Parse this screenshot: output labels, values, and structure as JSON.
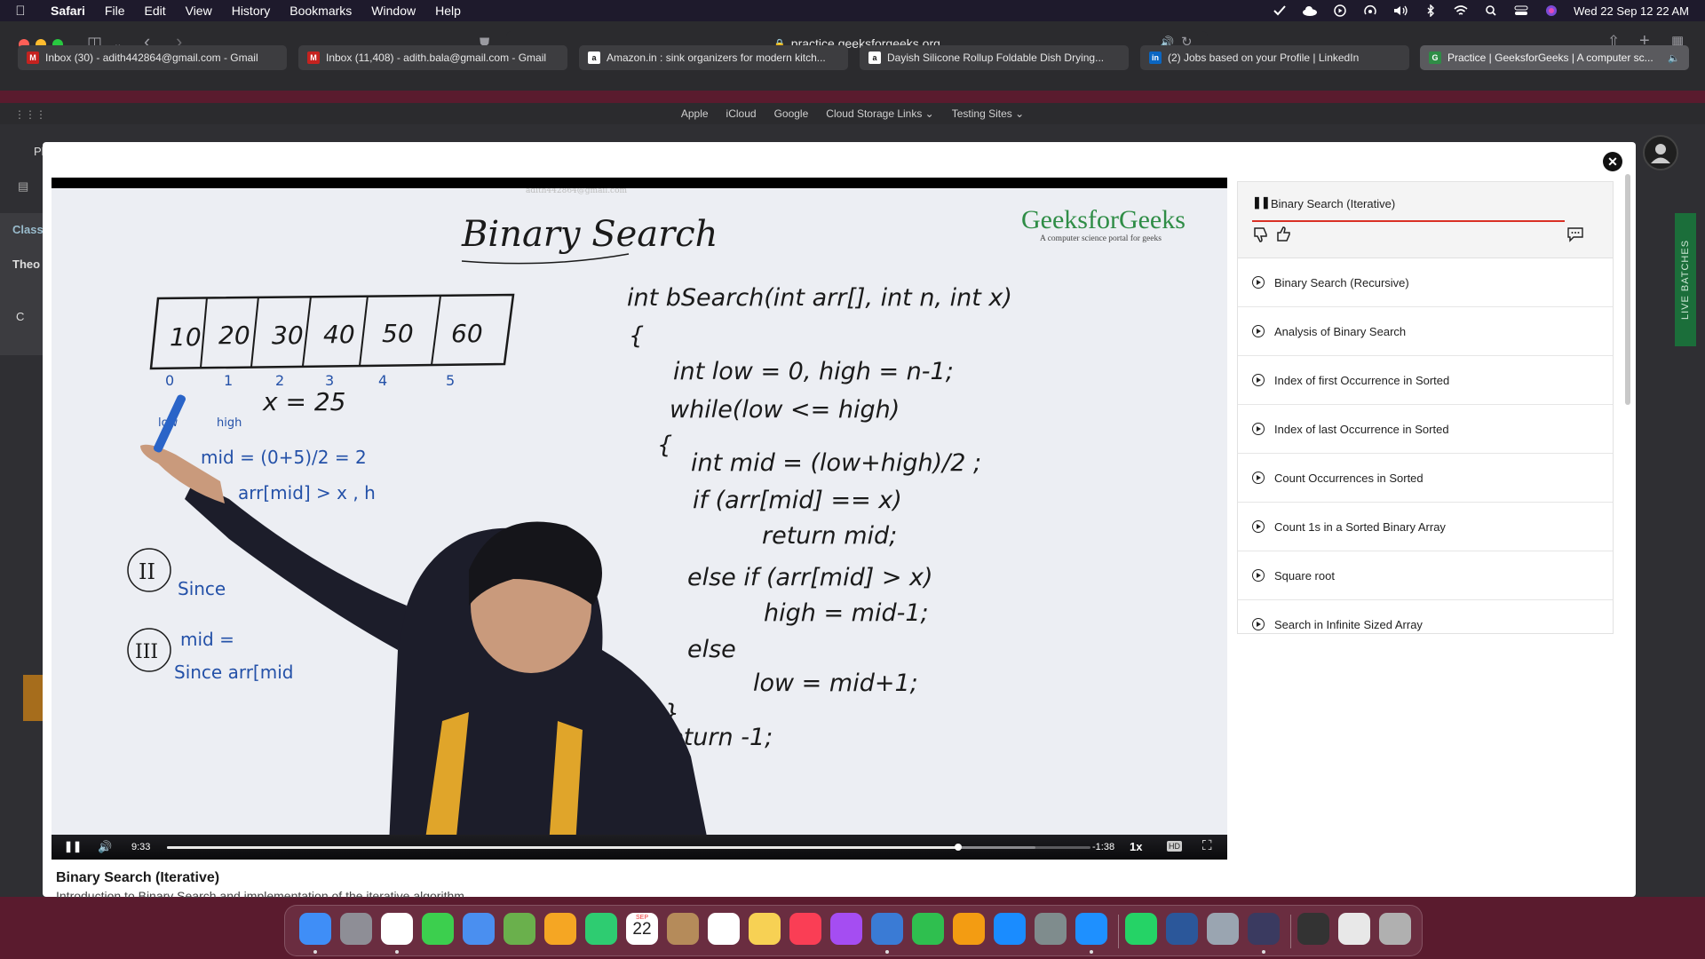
{
  "menubar": {
    "apple_icon": "apple-icon",
    "items": [
      "Safari",
      "File",
      "Edit",
      "View",
      "History",
      "Bookmarks",
      "Window",
      "Help"
    ],
    "clock": "Wed 22 Sep  12 22 AM",
    "status_icons": [
      "antivirus-icon",
      "cloud-icon",
      "play-circle-icon",
      "airdrop-icon",
      "volume-icon",
      "bluetooth-icon",
      "wifi-icon",
      "search-icon",
      "control-center-icon",
      "siri-icon"
    ]
  },
  "browser": {
    "url": "practice.geeksforgeeks.org",
    "tabs": [
      {
        "label": "Inbox (30) - adith442864@gmail.com - Gmail",
        "icon": "gmail-icon"
      },
      {
        "label": "Inbox (11,408) - adith.bala@gmail.com - Gmail",
        "icon": "gmail-icon"
      },
      {
        "label": "Amazon.in : sink organizers for modern kitch...",
        "icon": "amazon-icon"
      },
      {
        "label": "Dayish Silicone Rollup Foldable Dish Drying...",
        "icon": "amazon-icon"
      },
      {
        "label": "(2) Jobs based on your Profile | LinkedIn",
        "icon": "linkedin-icon"
      },
      {
        "label": "Practice | GeeksforGeeks | A computer sc...",
        "icon": "gfg-icon"
      }
    ],
    "favorites": [
      "Apple",
      "iCloud",
      "Google",
      "Cloud Storage Links ⌄",
      "Testing Sites ⌄"
    ]
  },
  "page_bg": {
    "snippets": [
      "Pl",
      "Class",
      "Theo",
      "C",
      "LIVE BATCHES"
    ]
  },
  "video": {
    "watermark": "adith442864@gmail.com",
    "logo_title": "GeeksforGeeks",
    "logo_tagline": "A computer science portal for geeks",
    "board": {
      "heading": "Binary Search",
      "array_values": [
        "10",
        "20",
        "30",
        "40",
        "50",
        "60"
      ],
      "array_indices": [
        "0",
        "1",
        "2",
        "3",
        "4",
        "5"
      ],
      "low_label": "low",
      "high_label": "high",
      "x_eq": "x = 25",
      "mid_eq": "mid = (0+5)/2 = 2",
      "arr_cmp": "arr[mid] > x , h",
      "step_two": "II",
      "step_three": "III",
      "since_label": "Since",
      "mid_line": "mid =",
      "since_arr": "Since arr[mid",
      "code": [
        "int bSearch(int arr[], int n, int x)",
        "{",
        "int low = 0, high = n-1;",
        "while(low <= high)",
        "{",
        "int mid = (low+high)/2 ;",
        "if (arr[mid] == x)",
        "return mid;",
        "else if (arr[mid] > x)",
        "high = mid-1;",
        "else",
        "low = mid+1;",
        "}",
        "return -1;",
        "}"
      ]
    },
    "controls": {
      "elapsed": "9:33",
      "remaining": "-1:38",
      "speed": "1x",
      "progress": 0.857,
      "buffered": 0.94
    },
    "title": "Binary Search (Iterative)",
    "description": "Introduction to Binary Search and implementation of the iterative algorithm."
  },
  "playlist": {
    "current": "Binary Search (Iterative)",
    "current_progress": 0.88,
    "items": [
      "Binary Search (Recursive)",
      "Analysis of Binary Search",
      "Index of first Occurrence in Sorted",
      "Index of last Occurrence in Sorted",
      "Count Occurrences in Sorted",
      "Count 1s in a Sorted Binary Array",
      "Square root",
      "Search in Infinite Sized Array"
    ]
  },
  "dock": {
    "apps": [
      "finder-icon",
      "launchpad-icon",
      "chrome-icon",
      "messages-icon",
      "mail-icon",
      "maps-icon",
      "photos-icon",
      "facetime-icon",
      "calendar-icon",
      "contacts-icon",
      "reminders-icon",
      "notes-icon",
      "music-icon",
      "podcasts-icon",
      "keynote-icon",
      "numbers-icon",
      "pages-icon",
      "app-store-icon",
      "system-preferences-icon",
      "safari-icon",
      "whatsapp-icon",
      "word-icon",
      "preview-icon",
      "app-icon",
      "screenshot-icon",
      "file-icon",
      "trash-icon"
    ],
    "calendar_month": "SEP",
    "calendar_day": "22"
  }
}
